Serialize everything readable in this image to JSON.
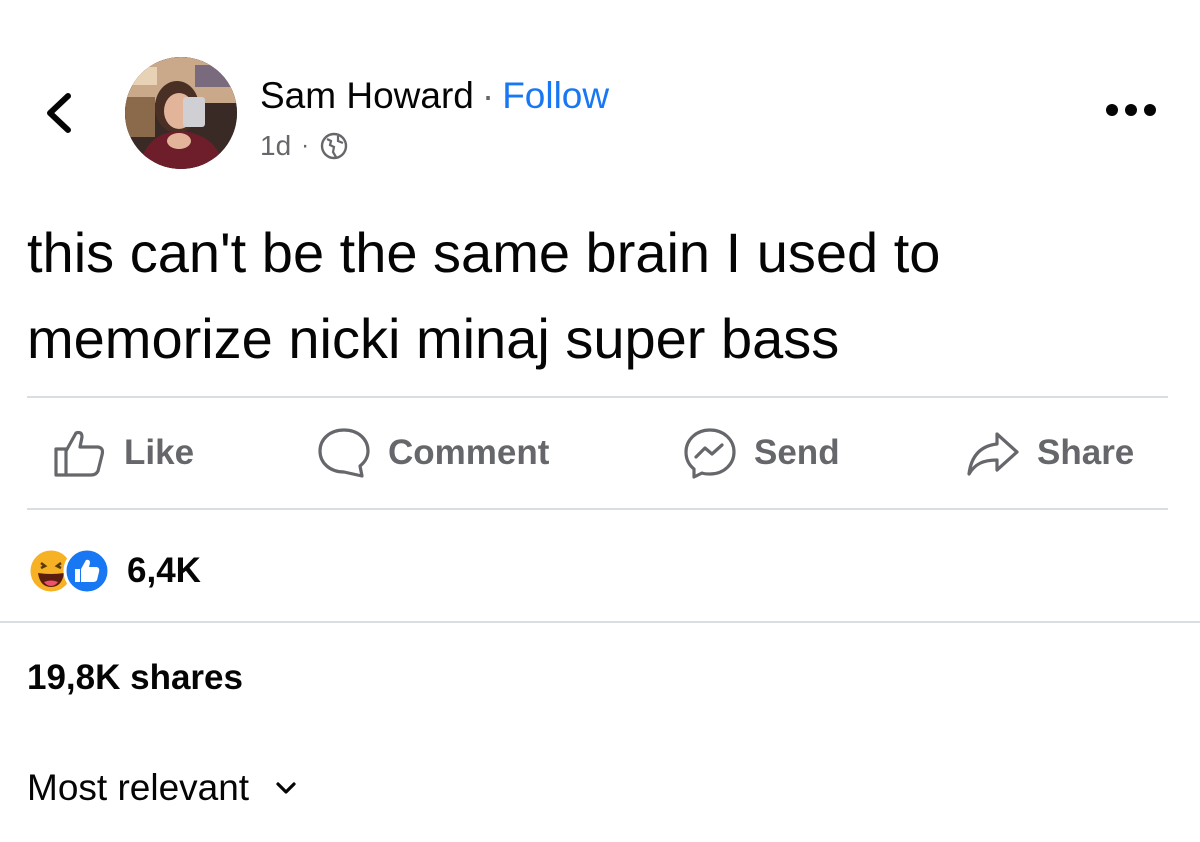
{
  "header": {
    "author_name": "Sam Howard",
    "separator": "·",
    "follow_label": "Follow",
    "timestamp": "1d",
    "meta_separator": "·",
    "privacy_icon": "globe-icon",
    "back_icon": "chevron-left-icon",
    "more_icon": "more-options-icon"
  },
  "post": {
    "text": "this can't be the same brain I used to memorize nicki minaj super bass"
  },
  "actions": {
    "like": "Like",
    "comment": "Comment",
    "send": "Send",
    "share": "Share"
  },
  "reactions": {
    "count": "6,4K",
    "types": [
      "haha",
      "like"
    ]
  },
  "shares": {
    "label": "19,8K shares"
  },
  "comments": {
    "sort_label": "Most relevant"
  },
  "colors": {
    "follow": "#1877f2",
    "secondary_text": "#65676b",
    "divider": "#dadde1",
    "like_reaction": "#1877f2",
    "haha_reaction": "#f7b125"
  }
}
